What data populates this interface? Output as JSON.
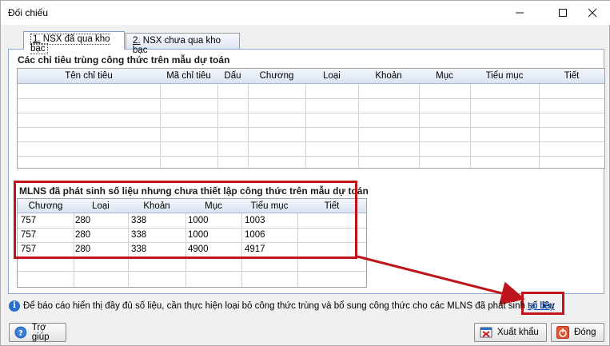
{
  "window": {
    "title": "Đối chiếu"
  },
  "tabs": [
    {
      "num": "1.",
      "label": "NSX đã qua kho bạc"
    },
    {
      "num": "2.",
      "label": "NSX chưa qua kho bạc"
    }
  ],
  "section1": {
    "title": "Các chỉ tiêu trùng công thức trên mẫu dự toán",
    "columns": [
      "Tên chỉ tiêu",
      "Mã chỉ tiêu",
      "Dấu",
      "Chương",
      "Loại",
      "Khoản",
      "Mục",
      "Tiểu mục",
      "Tiết"
    ]
  },
  "section2": {
    "title": "MLNS đã phát sinh số liệu nhưng chưa thiết lập công thức trên mẫu dự toán",
    "columns": [
      "Chương",
      "Loại",
      "Khoản",
      "Mục",
      "Tiểu mục",
      "Tiết"
    ],
    "rows": [
      [
        "757",
        "280",
        "338",
        "1000",
        "1003",
        ""
      ],
      [
        "757",
        "280",
        "338",
        "1000",
        "1006",
        ""
      ],
      [
        "757",
        "280",
        "338",
        "4900",
        "4917",
        ""
      ]
    ]
  },
  "info": {
    "text": "Để báo cáo hiển thị đầy đủ số liệu, cần thực hiện loại bỏ công thức trùng và bổ sung công thức cho các MLNS đã phát sinh số liệu",
    "link": "tại đây"
  },
  "buttons": {
    "help": "Trợ giúp",
    "export": "Xuất khẩu",
    "close": "Đóng"
  },
  "colors": {
    "highlight": "#c0141c",
    "link": "#0645ad"
  }
}
